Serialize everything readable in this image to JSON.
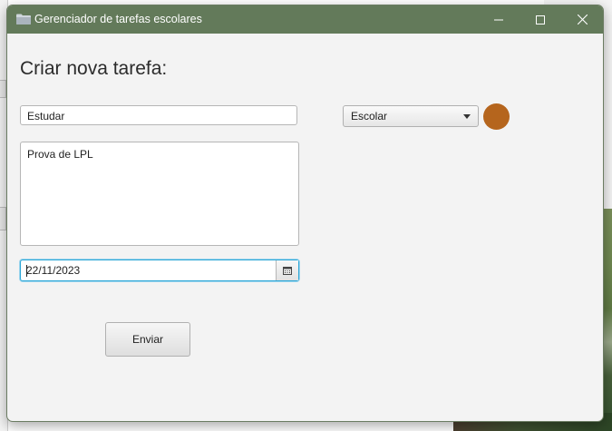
{
  "window": {
    "title": "Gerenciador de tarefas escolares",
    "titlebar_color": "#637a5a",
    "controls": [
      "minimize-icon",
      "maximize-icon",
      "close-icon"
    ]
  },
  "form": {
    "heading": "Criar nova tarefa:",
    "title_field": {
      "value": "Estudar"
    },
    "description_field": {
      "value": "Prova de LPL"
    },
    "date_field": {
      "value": "22/11/2023",
      "icon": "calendar-icon"
    },
    "category_select": {
      "selected": "Escolar"
    },
    "category_color": "#b5651d",
    "submit_label": "Enviar"
  }
}
